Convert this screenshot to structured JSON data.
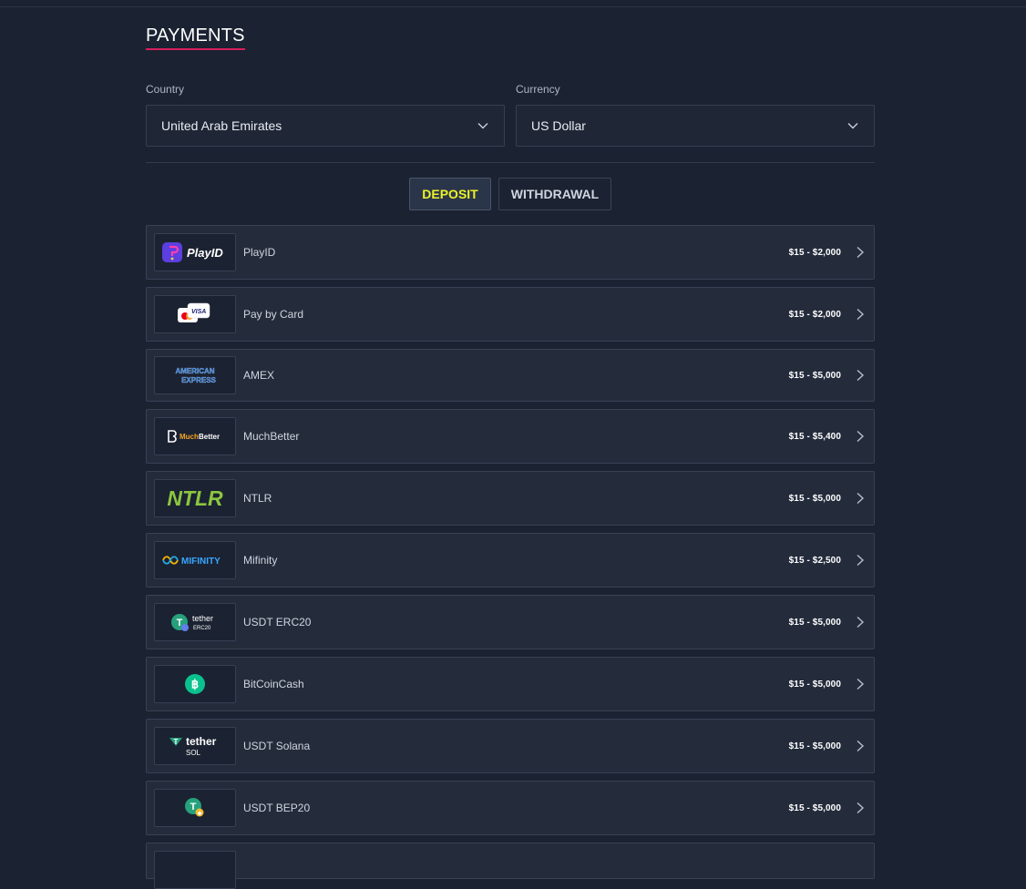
{
  "page": {
    "title": "PAYMENTS"
  },
  "filters": {
    "country": {
      "label": "Country",
      "value": "United Arab Emirates"
    },
    "currency": {
      "label": "Currency",
      "value": "US Dollar"
    }
  },
  "tabs": [
    {
      "label": "DEPOSIT",
      "active": true
    },
    {
      "label": "WITHDRAWAL",
      "active": false
    }
  ],
  "methods": [
    {
      "name": "PlayID",
      "range": "$15 - $2,000",
      "icon": "playid-logo-icon"
    },
    {
      "name": "Pay by Card",
      "range": "$15 - $2,000",
      "icon": "card-logo-icon"
    },
    {
      "name": "AMEX",
      "range": "$15 - $5,000",
      "icon": "amex-logo-icon"
    },
    {
      "name": "MuchBetter",
      "range": "$15 - $5,400",
      "icon": "muchbetter-logo-icon"
    },
    {
      "name": "NTLR",
      "range": "$15 - $5,000",
      "icon": "ntlr-logo-icon"
    },
    {
      "name": "Mifinity",
      "range": "$15 - $2,500",
      "icon": "mifinity-logo-icon"
    },
    {
      "name": "USDT ERC20",
      "range": "$15 - $5,000",
      "icon": "tether-erc20-logo-icon"
    },
    {
      "name": "BitCoinCash",
      "range": "$15 - $5,000",
      "icon": "bitcoincash-logo-icon"
    },
    {
      "name": "USDT Solana",
      "range": "$15 - $5,000",
      "icon": "tether-sol-logo-icon"
    },
    {
      "name": "USDT BEP20",
      "range": "$15 - $5,000",
      "icon": "tether-bep20-logo-icon"
    }
  ],
  "logos": {
    "playid": "PlayID",
    "visa": "VISA",
    "amex_line1": "AMERICAN",
    "amex_line2": "EXPRESS",
    "muchbetter_much": "Much",
    "muchbetter_better": "Better",
    "ntlr": "NTLR",
    "mifinity": "MIFINITY",
    "tether": "tether",
    "erc20": "ERC20",
    "sol": "SOL"
  },
  "colors": {
    "background": "#1b2232",
    "row": "#242c3c",
    "accent_underline": "#d81e5b",
    "active_tab_text": "#eaf22a"
  }
}
